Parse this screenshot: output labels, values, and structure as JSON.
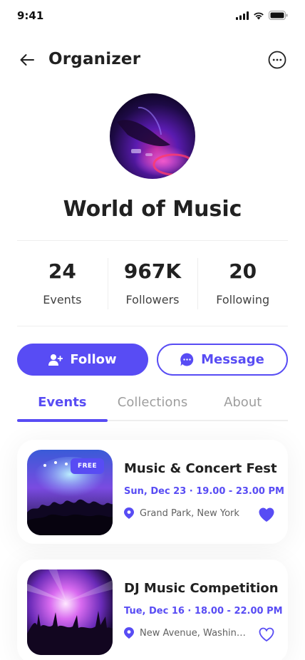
{
  "status": {
    "time": "9:41"
  },
  "header": {
    "title": "Organizer"
  },
  "organizer": {
    "name": "World of Music"
  },
  "stats": [
    {
      "value": "24",
      "label": "Events"
    },
    {
      "value": "967K",
      "label": "Followers"
    },
    {
      "value": "20",
      "label": "Following"
    }
  ],
  "actions": {
    "follow_label": "Follow",
    "message_label": "Message"
  },
  "tabs": [
    {
      "label": "Events",
      "active": true
    },
    {
      "label": "Collections",
      "active": false
    },
    {
      "label": "About",
      "active": false
    }
  ],
  "events": [
    {
      "title": "Music & Concert Fest",
      "date": "Sun, Dec 23 · 19.00 - 23.00 PM",
      "location": "Grand Park, New York",
      "badge": "FREE",
      "favorited": true
    },
    {
      "title": "DJ Music Competition",
      "date": "Tue, Dec 16 · 18.00 - 22.00 PM",
      "location": "New Avenue, Washing...",
      "badge": "",
      "favorited": false
    }
  ],
  "colors": {
    "primary": "#584CF4",
    "text": "#212121",
    "muted": "#9E9E9E"
  }
}
